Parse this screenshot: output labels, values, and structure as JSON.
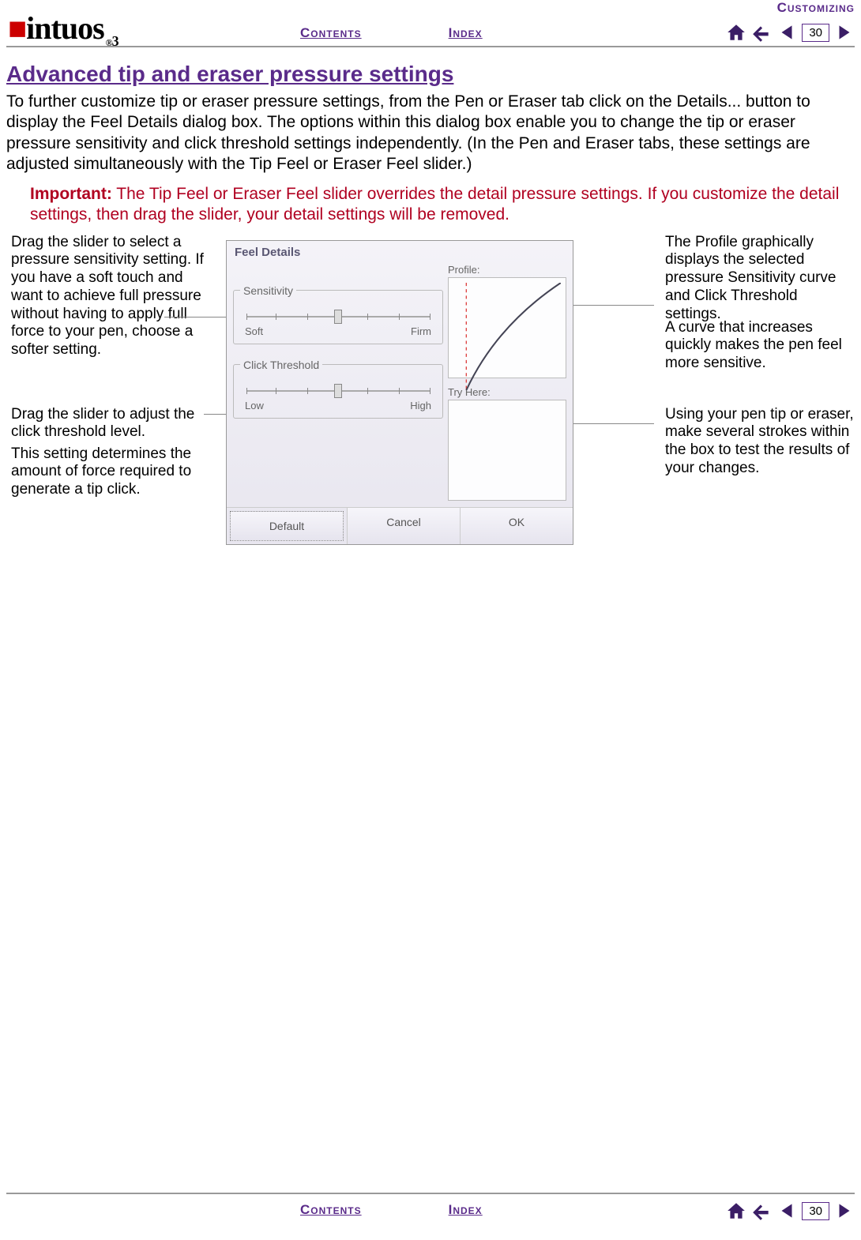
{
  "brand": {
    "name": "intuos",
    "sub": "3"
  },
  "nav": {
    "section": "Customizing",
    "contents": "Contents",
    "index": "Index",
    "page": "30"
  },
  "page": {
    "title": "Advanced tip and eraser pressure settings",
    "para": "To further customize tip or eraser pressure settings, from the Pen or Eraser tab click on the Details... button to display the Feel Details dialog box.  The options within this dialog box enable you to change the tip or eraser pressure sensitivity and click threshold settings independently.  (In the Pen and Eraser tabs, these settings are adjusted simultaneously with the Tip Feel or Eraser Feel slider.)",
    "important_label": "Important:",
    "important_text": " The Tip Feel or Eraser Feel slider overrides the detail pressure settings.  If you customize the detail settings, then drag the slider, your detail settings will be removed."
  },
  "callouts": {
    "sensitivity": "Drag the slider to select a pressure sensitivity setting. If you have a soft touch and want to achieve full pressure without having to apply full force to your pen, choose a softer setting.",
    "threshold_a": "Drag the slider to adjust the click threshold level.",
    "threshold_b": "This setting determines the amount of force required to generate a tip click.",
    "profile_a": "The Profile graphically displays the selected pressure Sensitivity curve and Click Threshold settings.",
    "profile_b": "A curve that increases quickly makes the pen feel more sensitive.",
    "tryhere": "Using your pen tip or eraser, make several strokes within the box to test the results of your changes."
  },
  "dialog": {
    "title": "Feel Details",
    "sensitivity": {
      "legend": "Sensitivity",
      "low": "Soft",
      "high": "Firm"
    },
    "threshold": {
      "legend": "Click Threshold",
      "low": "Low",
      "high": "High"
    },
    "profile_label": "Profile:",
    "tryhere_label": "Try Here:",
    "buttons": {
      "default": "Default",
      "cancel": "Cancel",
      "ok": "OK"
    }
  }
}
